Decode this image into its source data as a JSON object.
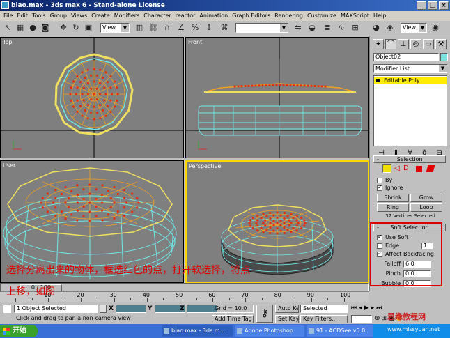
{
  "titlebar": {
    "title": "biao.max - 3ds max 6 - Stand-alone License",
    "min": "_",
    "max": "□",
    "close": "×"
  },
  "menu": [
    "File",
    "Edit",
    "Tools",
    "Group",
    "Views",
    "Create",
    "Modifiers",
    "Character",
    "reactor",
    "Animation",
    "Graph Editors",
    "Rendering",
    "Customize",
    "MAXScript",
    "Help"
  ],
  "toolbar": {
    "view_dropdown": "View",
    "view_dropdown_right": "View"
  },
  "viewports": {
    "top": "Top",
    "front": "Front",
    "user": "User",
    "perspective": "Perspective"
  },
  "command_panel": {
    "object_name": "Object02",
    "modifier_list": "Modifier List",
    "stack_item": "Editable Poly",
    "selection": {
      "title": "Selection",
      "by_label": "By",
      "ignore_label": "Ignore",
      "shrink": "Shrink",
      "grow": "Grow",
      "ring": "Ring",
      "loop": "Loop",
      "status": "37 Vertices Selected"
    },
    "soft_selection": {
      "title": "Soft Selection",
      "use_soft": "Use Soft",
      "edge": "Edge",
      "edge_value": "1",
      "affect_backfacing": "Affect Backfacing",
      "falloff_label": "Falloff",
      "falloff_value": "6.0",
      "pinch_label": "Pinch",
      "pinch_value": "0.0",
      "bubble_label": "Bubble",
      "bubble_value": "0.0"
    }
  },
  "instruction": {
    "line1": "选择分离出来的物体，框选红色的点，打开软选择，将点",
    "line2": "上移，如图"
  },
  "timeline": {
    "slider": "0 / 100",
    "ticks": [
      "10",
      "20",
      "30",
      "40",
      "50",
      "60",
      "70",
      "80",
      "90",
      "100"
    ]
  },
  "status": {
    "selected_objects": "1 Object Selected",
    "prompt": "Click and drag to pan a non-camera view",
    "x_label": "X",
    "y_label": "Y",
    "z_label": "Z",
    "grid": "Grid = 10.0",
    "add_time_tag": "Add Time Tag",
    "auto_key": "Auto Key",
    "set_key": "Set Key",
    "selected_dropdown": "Selected",
    "key_filters": "Key Filters..."
  },
  "taskbar": {
    "start": "开始",
    "tasks": [
      "biao.max - 3ds m...",
      "Adobe Photoshop",
      "91 - ACDSee v5.0"
    ]
  },
  "watermark": {
    "line1": "思缘教程网",
    "line2": "www.missyuan.net"
  },
  "colors": {
    "vertex_selected": "#e53010",
    "wire_selected": "#f0a020",
    "wire_mesh": "#70e8e8",
    "viewport_bg": "#7f7f7f",
    "active_border": "#ffd800",
    "highlight_box": "#e00000"
  }
}
